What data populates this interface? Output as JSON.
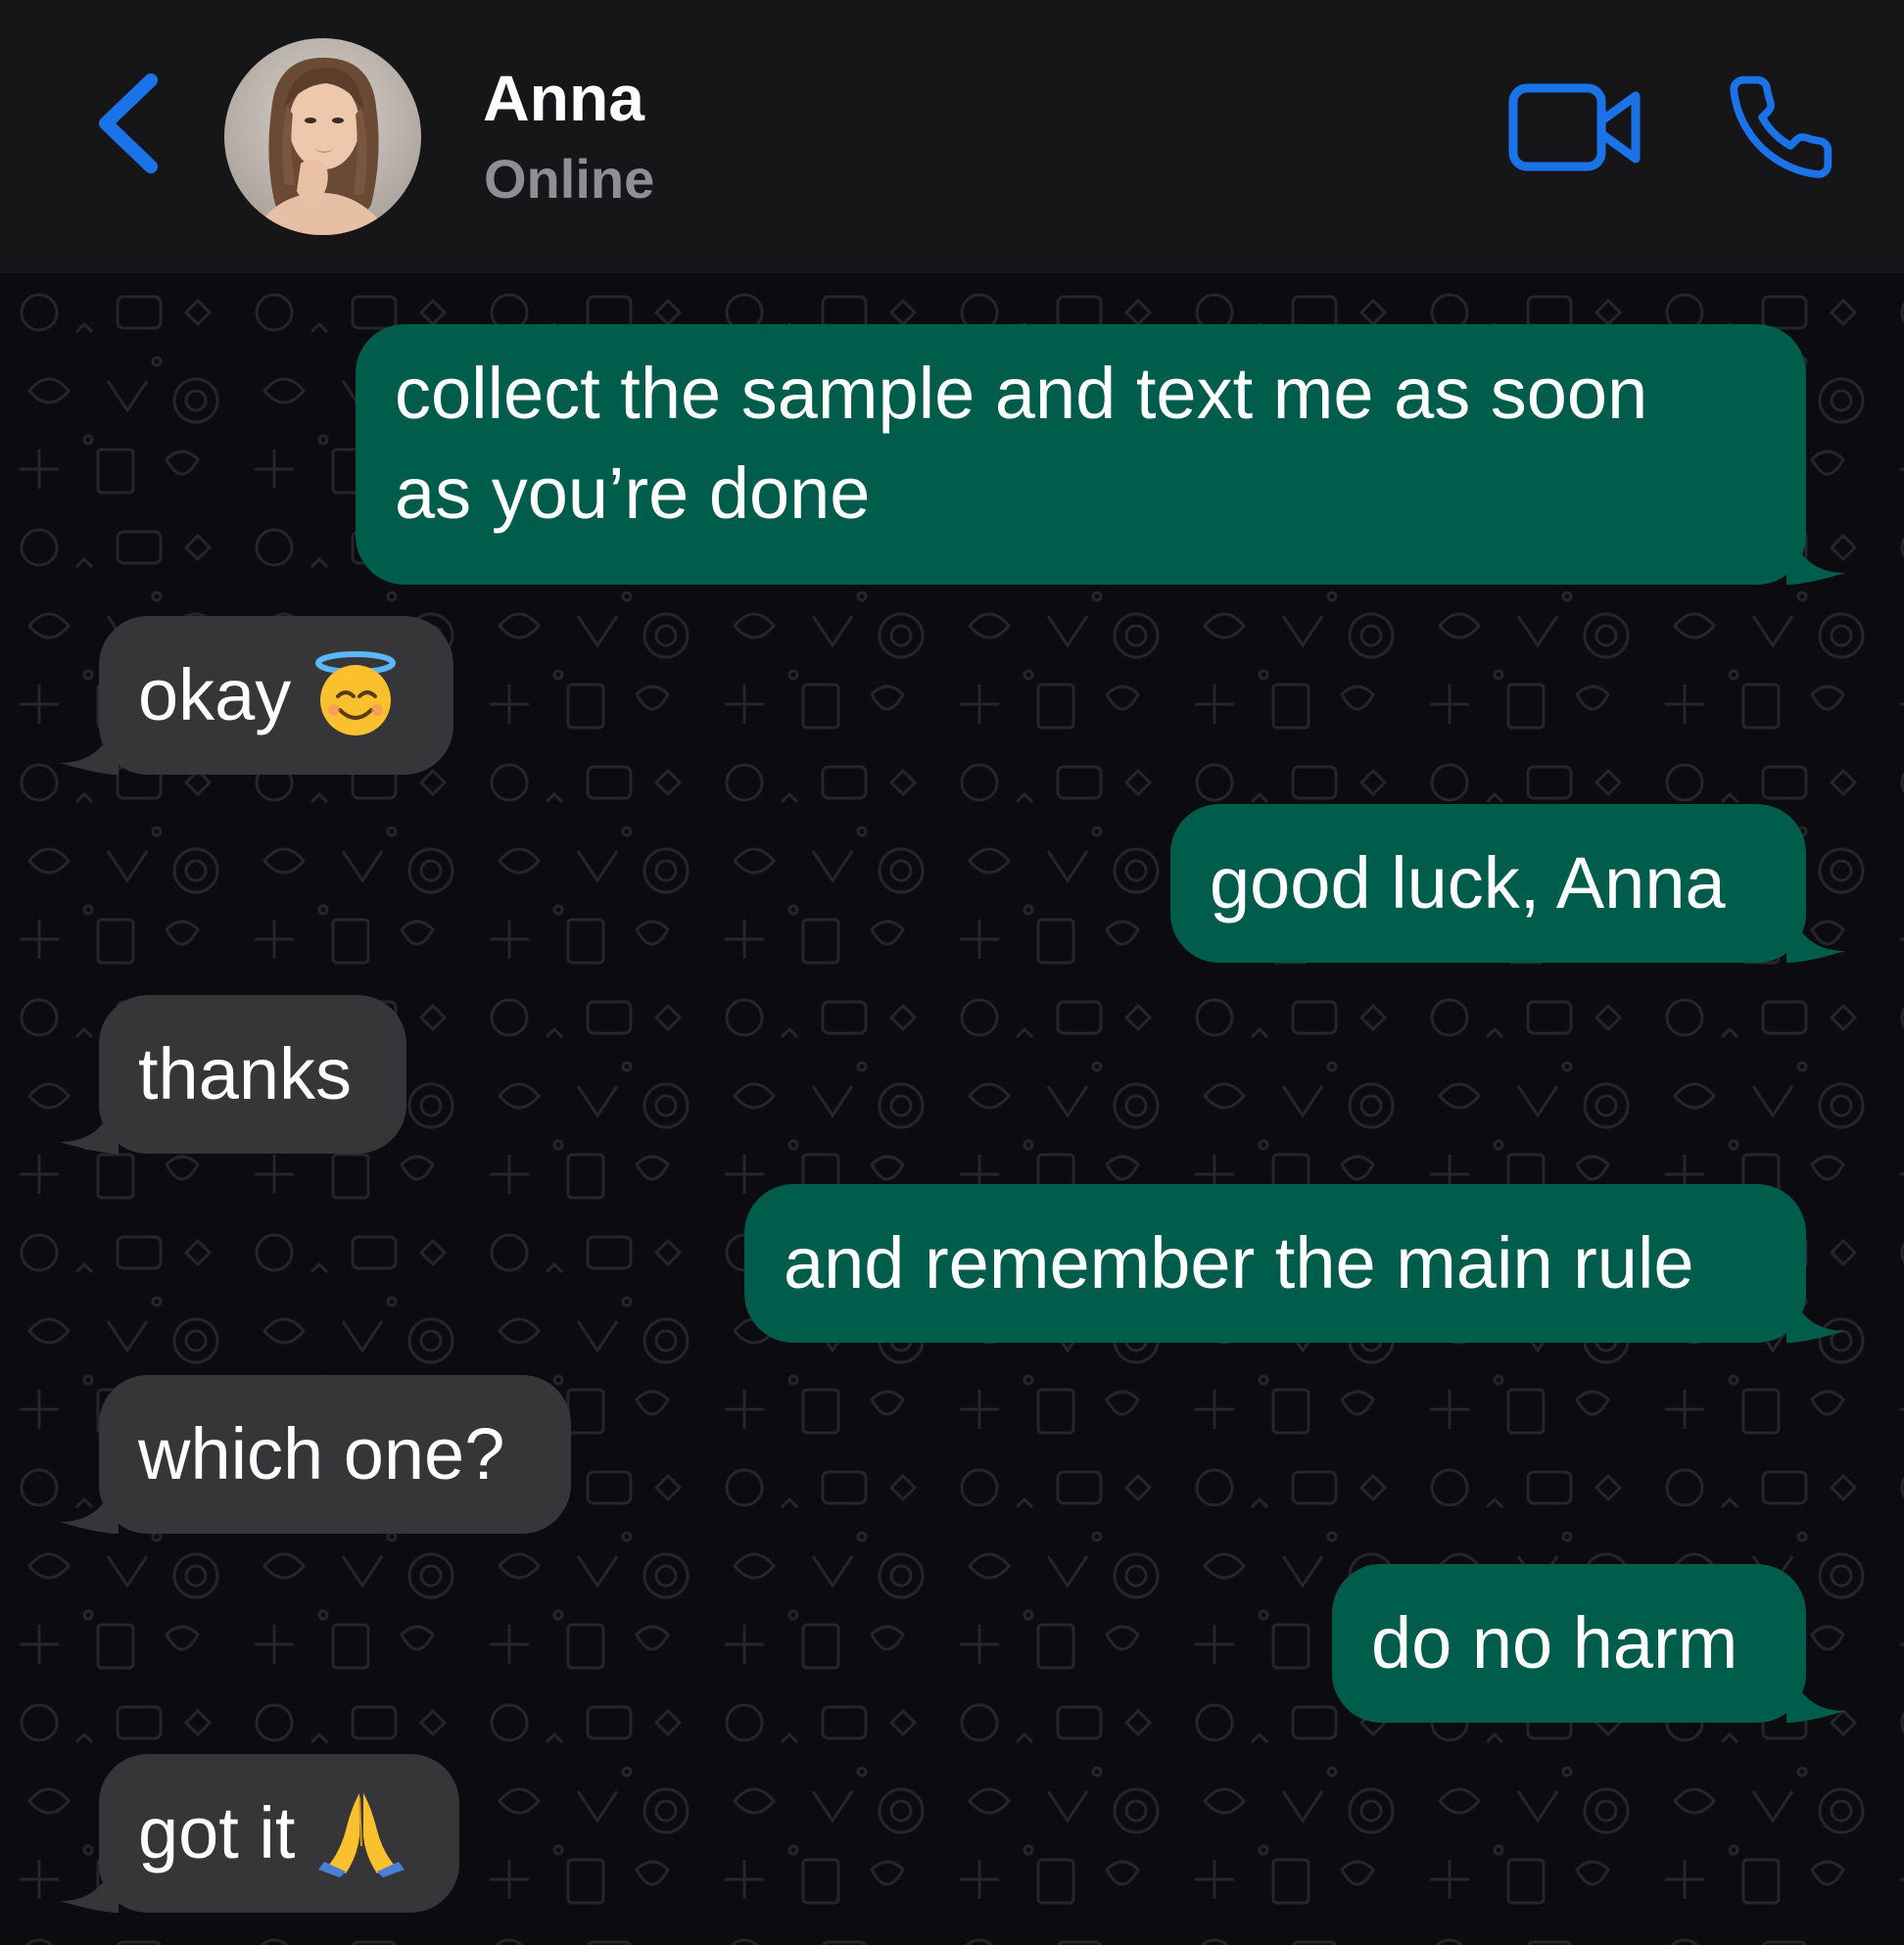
{
  "header": {
    "back_label": "Back",
    "contact_name": "Anna",
    "status": "Online",
    "back_icon": "chevron-left-icon",
    "video_icon": "video-camera-icon",
    "call_icon": "phone-icon",
    "accent_color": "#1a73e8"
  },
  "colors": {
    "header_bg": "#161618",
    "chat_bg": "#0b0b10",
    "outgoing_bubble": "#005c4b",
    "incoming_bubble": "#363638",
    "status_text": "#8e8e93"
  },
  "messages": [
    {
      "direction": "outgoing",
      "lines": [
        "collect the sample and text me as soon",
        "as you’re done"
      ]
    },
    {
      "direction": "incoming",
      "text": "okay",
      "emoji": "smiling-face-with-halo"
    },
    {
      "direction": "outgoing",
      "text": "good luck, Anna"
    },
    {
      "direction": "incoming",
      "text": "thanks"
    },
    {
      "direction": "outgoing",
      "text": "and remember the main rule"
    },
    {
      "direction": "incoming",
      "text": "which one?"
    },
    {
      "direction": "outgoing",
      "text": "do no harm"
    },
    {
      "direction": "incoming",
      "text": "got it",
      "emoji": "folded-hands"
    }
  ]
}
